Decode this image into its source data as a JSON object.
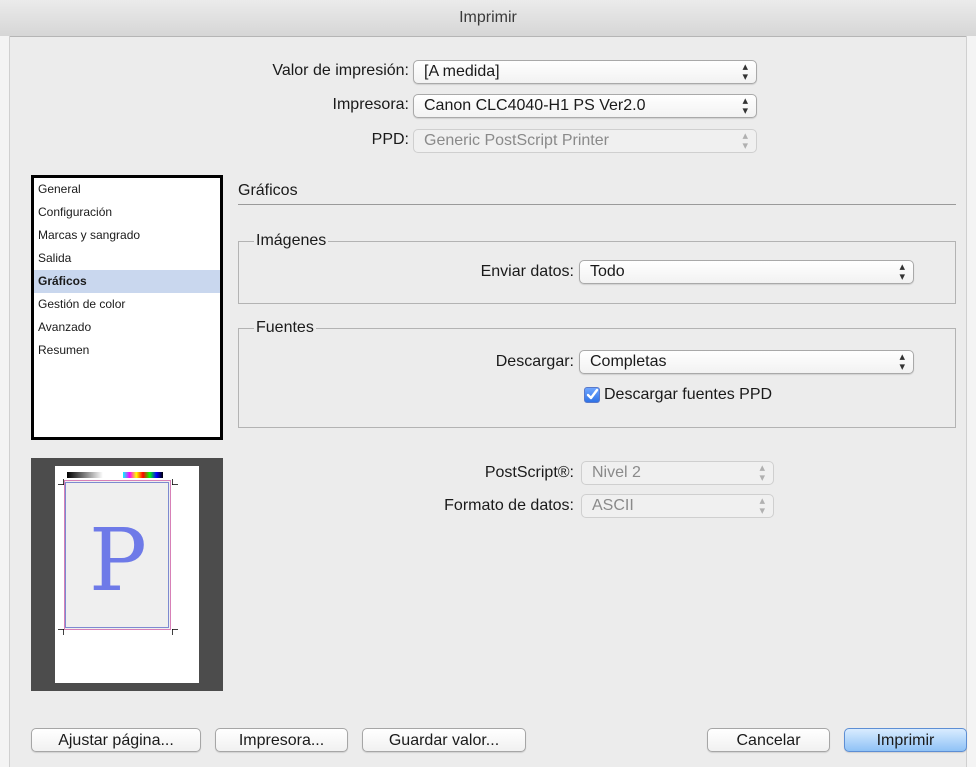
{
  "window": {
    "title": "Imprimir"
  },
  "top": {
    "preset_label": "Valor de impresión:",
    "preset_value": "[A medida]",
    "printer_label": "Impresora:",
    "printer_value": "Canon CLC4040-H1 PS Ver2.0",
    "ppd_label": "PPD:",
    "ppd_value": "Generic PostScript Printer"
  },
  "sidebar": {
    "items": [
      {
        "label": "General",
        "selected": false
      },
      {
        "label": "Configuración",
        "selected": false
      },
      {
        "label": "Marcas y sangrado",
        "selected": false
      },
      {
        "label": "Salida",
        "selected": false
      },
      {
        "label": "Gráficos",
        "selected": true
      },
      {
        "label": "Gestión de color",
        "selected": false
      },
      {
        "label": "Avanzado",
        "selected": false
      },
      {
        "label": "Resumen",
        "selected": false
      }
    ]
  },
  "main": {
    "section_title": "Gráficos",
    "images": {
      "group_title": "Imágenes",
      "send_label": "Enviar datos:",
      "send_value": "Todo"
    },
    "fonts": {
      "group_title": "Fuentes",
      "download_label": "Descargar:",
      "download_value": "Completas",
      "ppd_fonts_label": "Descargar fuentes PPD",
      "ppd_fonts_checked": true
    },
    "postscript_label": "PostScript®:",
    "postscript_value": "Nivel 2",
    "data_format_label": "Formato de datos:",
    "data_format_value": "ASCII"
  },
  "preview": {
    "letter": "P"
  },
  "buttons": {
    "page_setup": "Ajustar página...",
    "printer": "Impresora...",
    "save_preset": "Guardar valor...",
    "cancel": "Cancelar",
    "print": "Imprimir"
  },
  "icons": {
    "popup_arrows": "updown-chevron-icon",
    "checkmark": "checkmark-icon"
  },
  "colors": {
    "selection": "#c9d7ee",
    "primary_button": "#8fc2f6",
    "preview_letter": "#6e7ae8"
  }
}
